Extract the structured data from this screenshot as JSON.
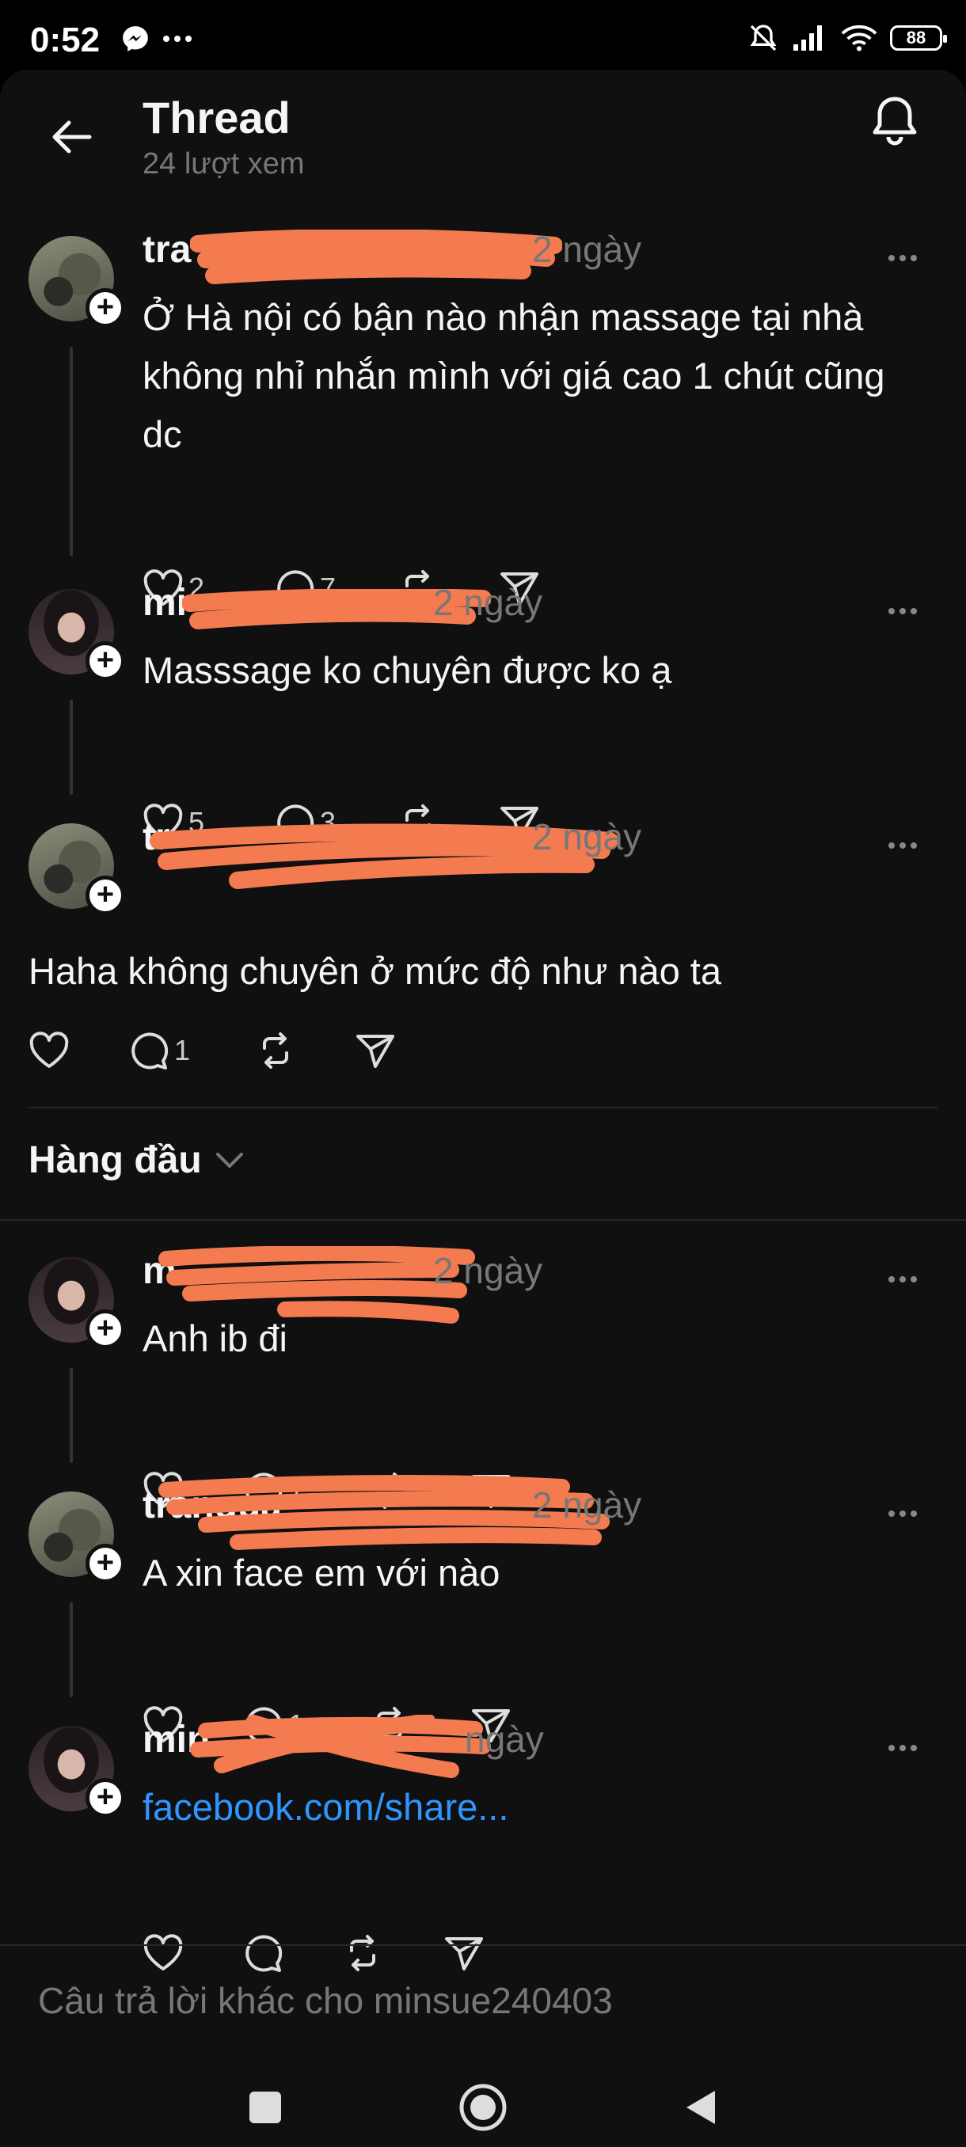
{
  "status_bar": {
    "time": "0:52",
    "battery": "88",
    "icons": [
      "messenger-icon",
      "more-dots-icon",
      "mute-icon",
      "signal-icon",
      "wifi-icon",
      "battery-icon"
    ]
  },
  "header": {
    "title": "Thread",
    "views": "24 lượt xem"
  },
  "posts": [
    {
      "username": "tra",
      "time": "2 ngày",
      "text": "Ở Hà nội có bận nào nhận massage tại nhà không nhỉ nhắn mình với giá cao 1 chút cũng dc",
      "likes": "2",
      "comments": "7"
    },
    {
      "username": "mi",
      "time": "2 ngày",
      "text": "Masssage ko chuyên được ko ạ",
      "likes": "5",
      "comments": "3"
    },
    {
      "username": "tr",
      "time": "2 ngày",
      "text": "Haha không chuyên ở mức độ như nào ta",
      "likes": "",
      "comments": "1"
    }
  ],
  "sort": {
    "label": "Hàng đầu"
  },
  "replies": [
    {
      "username": "m",
      "time": "2 ngày",
      "text": "Anh ib đi",
      "comments": "1"
    },
    {
      "username": "tranqua",
      "time": "2 ngày",
      "text": "A xin face em với nào",
      "comments": "1"
    },
    {
      "username": "min",
      "time": "ngày",
      "text": "facebook.com/share...",
      "comments": ""
    }
  ],
  "reply_bar": {
    "placeholder": "Câu trả lời khác cho minsue240403"
  },
  "colors": {
    "background": "#101010",
    "text": "#f3f5f7",
    "muted": "#777777",
    "link": "#2f95ff",
    "redaction": "#f47a50"
  }
}
